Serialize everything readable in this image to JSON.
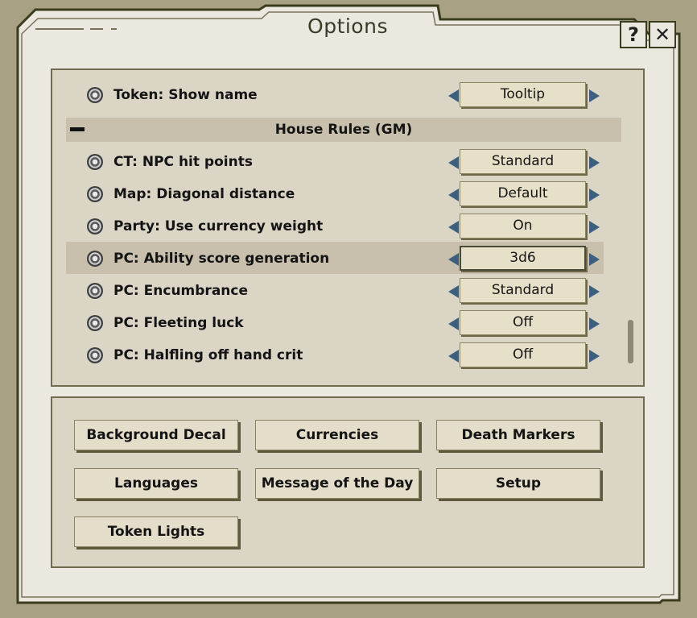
{
  "window": {
    "title": "Options"
  },
  "corner_buttons": {
    "help": "?",
    "close": "✕"
  },
  "options": {
    "first_row": {
      "label": "Token: Show name",
      "value": "Tooltip"
    },
    "group": {
      "title": "House Rules (GM)"
    },
    "rows": [
      {
        "label": "CT: NPC hit points",
        "value": "Standard"
      },
      {
        "label": "Map: Diagonal distance",
        "value": "Default"
      },
      {
        "label": "Party: Use currency weight",
        "value": "On"
      },
      {
        "label": "PC: Ability score generation",
        "value": "3d6",
        "selected": true
      },
      {
        "label": "PC: Encumbrance",
        "value": "Standard"
      },
      {
        "label": "PC: Fleeting luck",
        "value": "Off"
      },
      {
        "label": "PC: Halfling off hand crit",
        "value": "Off"
      }
    ]
  },
  "buttons": [
    "Background Decal",
    "Currencies",
    "Death Markers",
    "Languages",
    "Message of the Day",
    "Setup",
    "Token Lights"
  ],
  "colors": {
    "background": "#a8a184",
    "window": "#ebe8df",
    "panel": "#dbd5c6",
    "highlight": "#c8c0ac",
    "arrow": "#3d5f7e"
  }
}
